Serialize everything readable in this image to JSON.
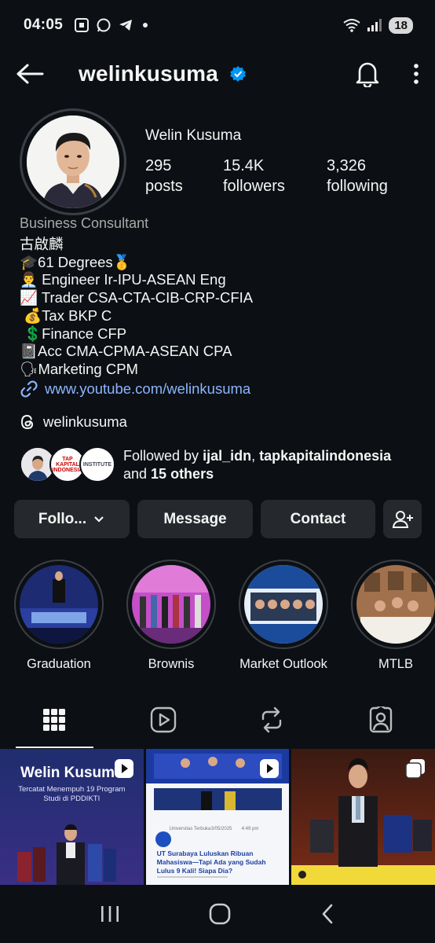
{
  "status_bar": {
    "time": "04:05",
    "battery": "18"
  },
  "header": {
    "username": "welinkusuma"
  },
  "profile": {
    "display_name": "Welin Kusuma",
    "stats": [
      {
        "value": "295",
        "label": "posts"
      },
      {
        "value": "15.4K",
        "label": "followers"
      },
      {
        "value": "3,326",
        "label": "following"
      }
    ],
    "category": "Business Consultant",
    "bio_lines": [
      "古啟麟",
      "🎓61 Degrees🥇",
      "👨‍💼 Engineer Ir-IPU-ASEAN Eng",
      "📈 Trader CSA-CTA-CIB-CRP-CFIA",
      " 💰Tax BKP C",
      " 💲Finance CFP",
      "📓Acc CMA-CPMA-ASEAN CPA",
      "🗣Marketing CPM"
    ],
    "link": "www.youtube.com/welinkusuma",
    "threads_handle": "welinkusuma",
    "followed_by": {
      "prefix": "Followed by ",
      "user1": "ijal_idn",
      "sep": ", ",
      "user2": "tapkapitalindonesia",
      "and": "and ",
      "others": "15 others",
      "mini_label_2": "TAP KAPITAL INDONESIA",
      "mini_label_3": "INSTITUTE"
    }
  },
  "actions": {
    "follow": "Follo...",
    "message": "Message",
    "contact": "Contact"
  },
  "highlights": [
    {
      "label": "Graduation"
    },
    {
      "label": "Brownis"
    },
    {
      "label": "Market Outlook"
    },
    {
      "label": "MTLB"
    }
  ],
  "grid": {
    "post1_title": "Welin Kusuma",
    "post1_subtitle": "Tercatat Menempuh 19 Program Studi di PDDIKTI",
    "post2_source": "Universitas Terbuka",
    "post2_date": "3/05/2025",
    "post2_time": "4:49 pm",
    "post2_headline": "UT Surabaya Luluskan Ribuan Mahasiswa—Tapi Ada yang Sudah Lulus 9 Kali! Siapa Dia?"
  },
  "colors": {
    "background": "#0c1014",
    "button": "#25292e",
    "link": "#8cb4ff",
    "verified": "#0095f6"
  }
}
